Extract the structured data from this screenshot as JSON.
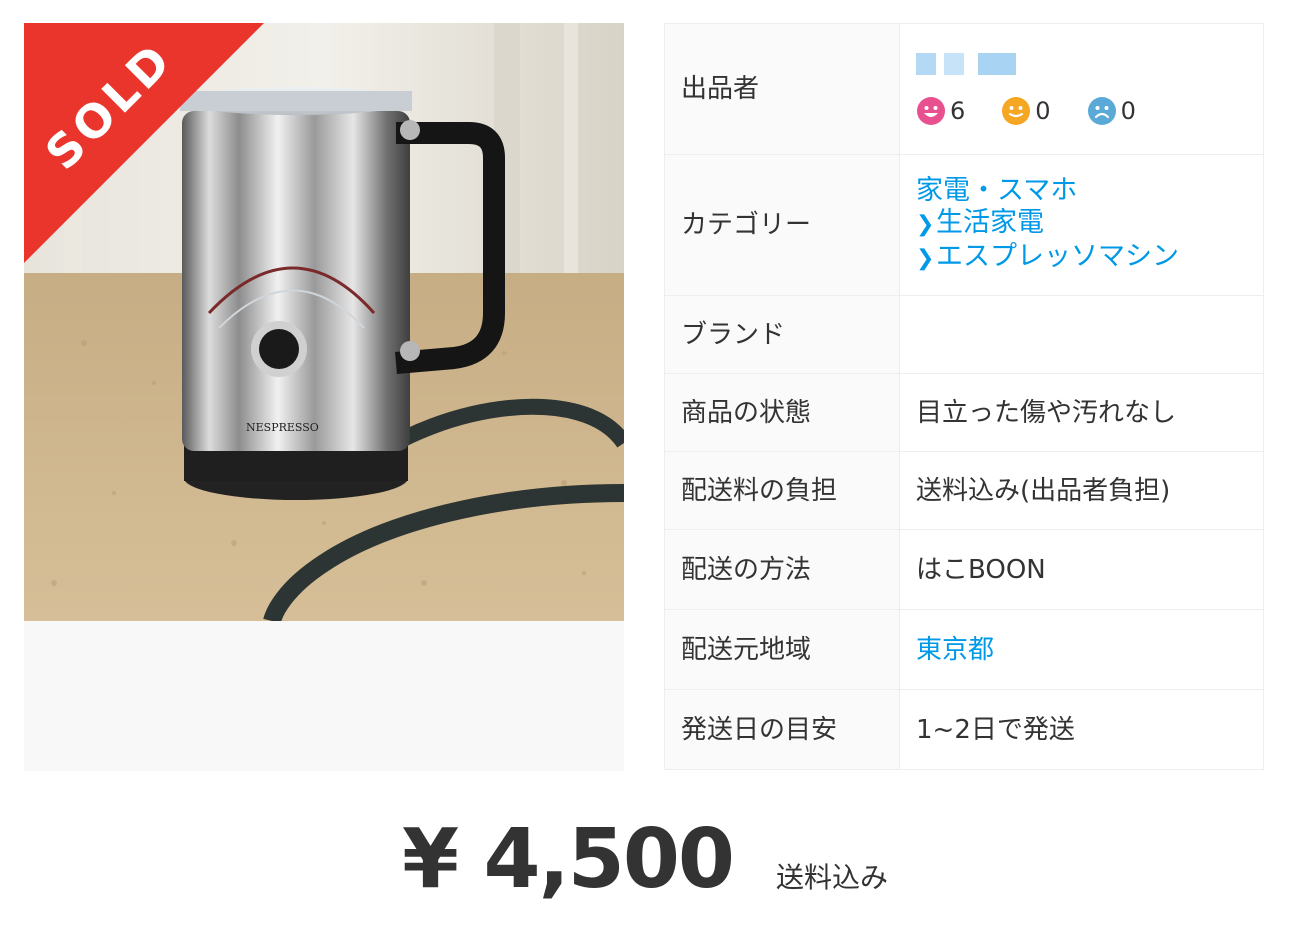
{
  "product": {
    "sold_label": "SOLD",
    "image_alt": "NESPRESSO milk frother",
    "image_brand_text": "NESPRESSO"
  },
  "details": {
    "seller": {
      "label": "出品者",
      "ratings": [
        {
          "icon": "good-face-icon",
          "color": "#e8508f",
          "count": "6"
        },
        {
          "icon": "normal-face-icon",
          "color": "#f5a623",
          "count": "0"
        },
        {
          "icon": "bad-face-icon",
          "color": "#5aa9d6",
          "count": "0"
        }
      ]
    },
    "category": {
      "label": "カテゴリー",
      "items": [
        "家電・スマホ",
        "生活家電",
        "エスプレッソマシン"
      ]
    },
    "brand": {
      "label": "ブランド",
      "value": ""
    },
    "condition": {
      "label": "商品の状態",
      "value": "目立った傷や汚れなし"
    },
    "shipping_fee": {
      "label": "配送料の負担",
      "value": "送料込み(出品者負担)"
    },
    "shipping_method": {
      "label": "配送の方法",
      "value": "はこBOON"
    },
    "shipping_from": {
      "label": "配送元地域",
      "value": "東京都"
    },
    "shipping_days": {
      "label": "発送日の目安",
      "value": "1~2日で発送"
    }
  },
  "price": {
    "amount": "¥ 4,500",
    "note": "送料込み"
  },
  "colors": {
    "link": "#0099e8",
    "sold_ribbon": "#ea352d",
    "border": "#eeeeee",
    "header_bg": "#fafafa"
  }
}
